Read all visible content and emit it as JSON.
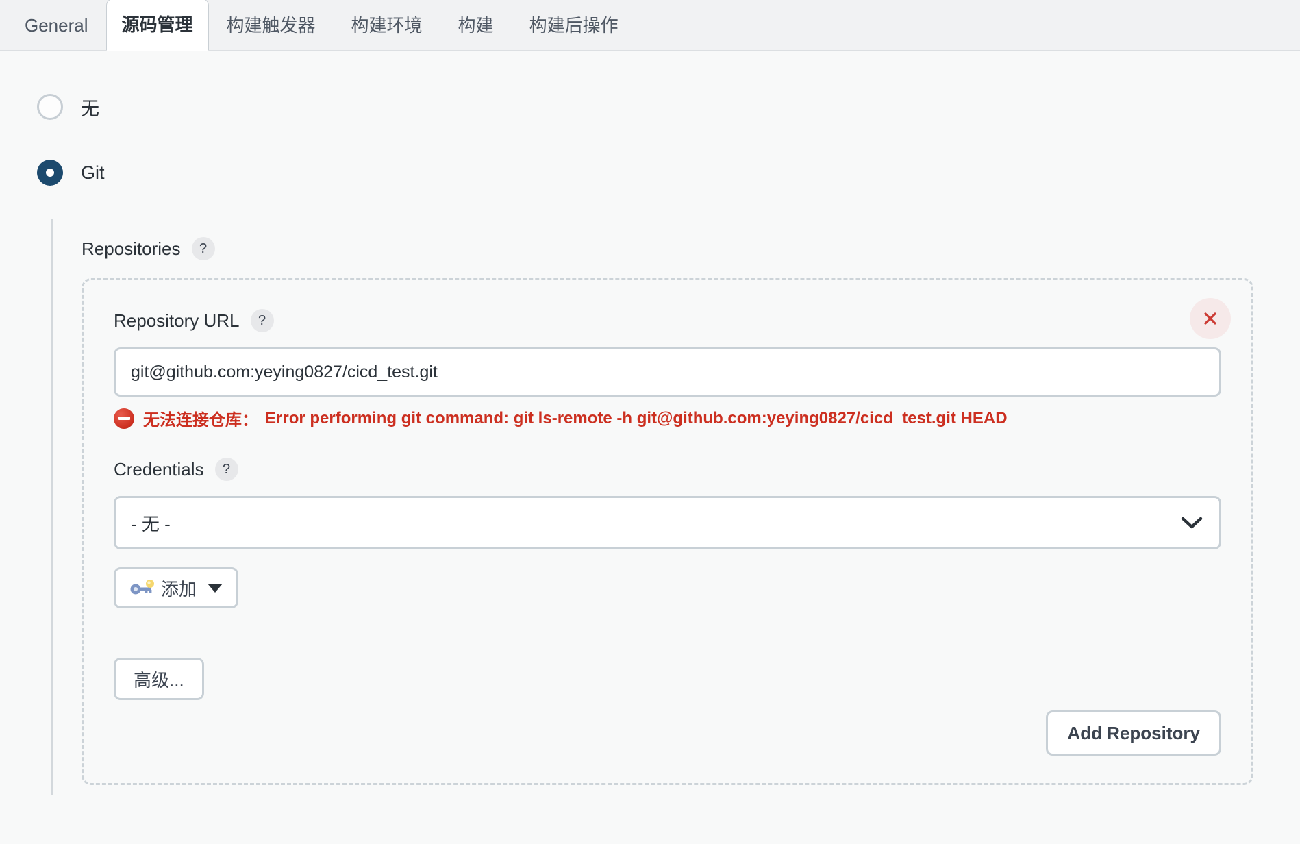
{
  "tabs": [
    {
      "label": "General",
      "active": false
    },
    {
      "label": "源码管理",
      "active": true
    },
    {
      "label": "构建触发器",
      "active": false
    },
    {
      "label": "构建环境",
      "active": false
    },
    {
      "label": "构建",
      "active": false
    },
    {
      "label": "构建后操作",
      "active": false
    }
  ],
  "scm": {
    "options": [
      {
        "label": "无",
        "selected": false
      },
      {
        "label": "Git",
        "selected": true
      }
    ]
  },
  "git": {
    "repositories_label": "Repositories",
    "help_glyph": "?",
    "repository_url_label": "Repository URL",
    "repository_url_value": "git@github.com:yeying0827/cicd_test.git",
    "repository_url_placeholder": "",
    "error": {
      "prefix": "无法连接仓库：",
      "message": "Error performing git command: git ls-remote -h git@github.com:yeying0827/cicd_test.git HEAD",
      "color": "#cc2f20"
    },
    "credentials_label": "Credentials",
    "credentials_selected": "- 无 -",
    "credentials_options": [
      "- 无 -"
    ],
    "add_credentials_label": "添加",
    "advanced_label": "高级...",
    "add_repository_label": "Add Repository",
    "delete_repository_label": "×"
  },
  "colors": {
    "accent": "#1c4a6e",
    "error": "#cc2f20",
    "border": "#c8d0d6",
    "page_bg": "#f8f9f9",
    "tabbar_bg": "#f1f2f3"
  }
}
